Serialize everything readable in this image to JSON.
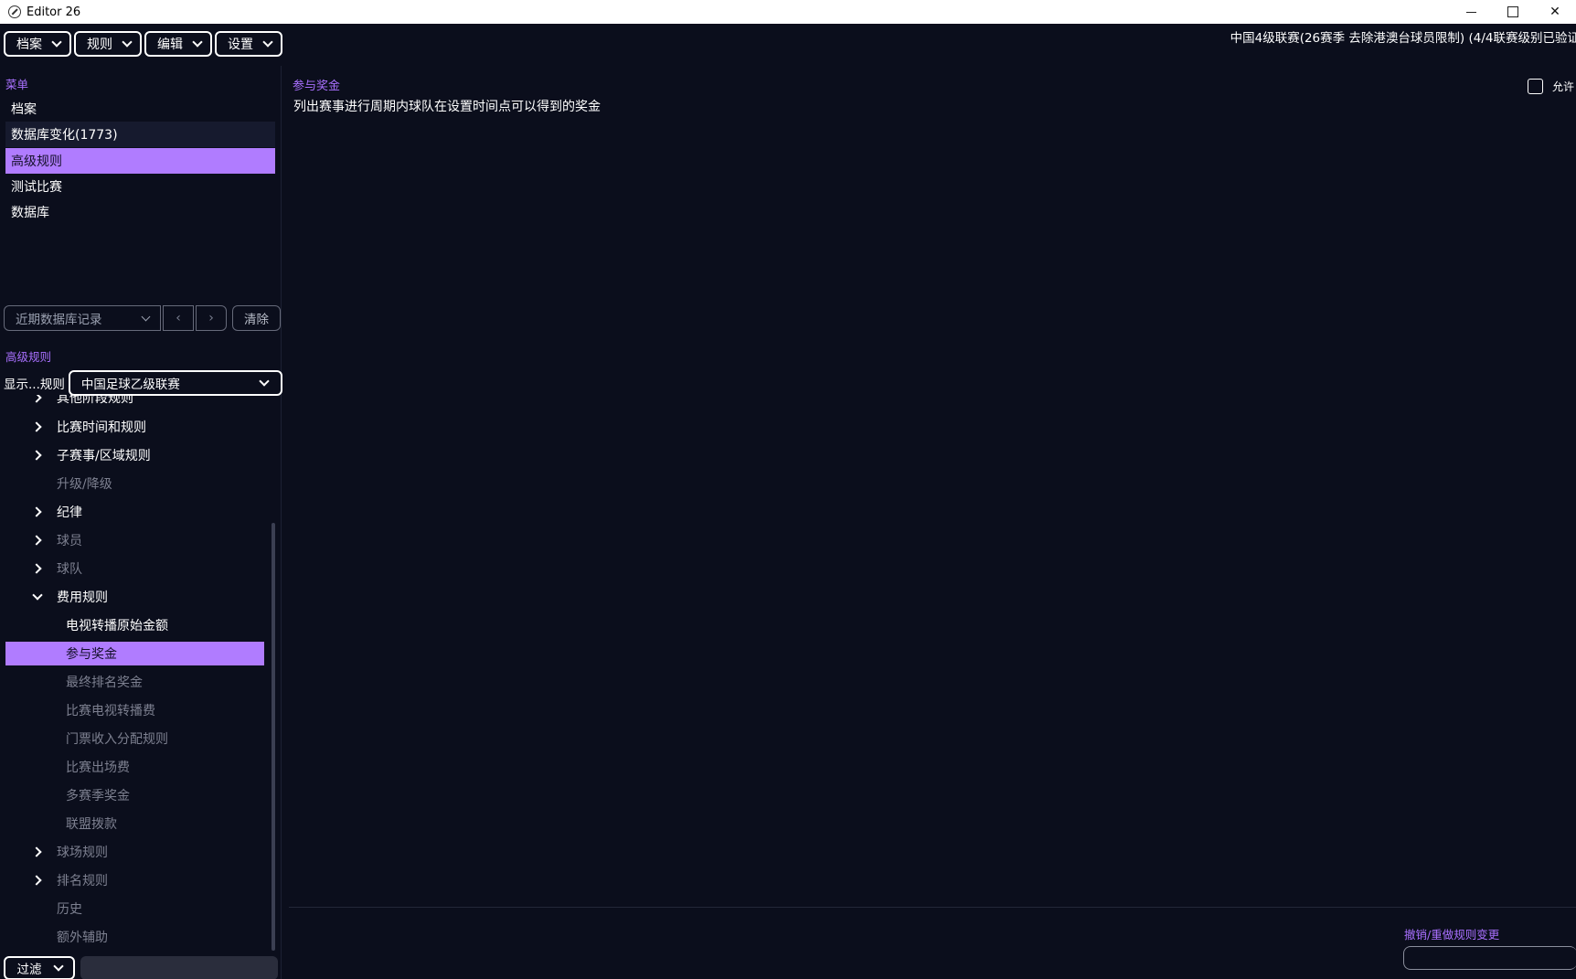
{
  "window": {
    "title": "Editor 26"
  },
  "menubar": {
    "items": [
      {
        "label": "档案"
      },
      {
        "label": "规则"
      },
      {
        "label": "编辑"
      },
      {
        "label": "设置"
      }
    ]
  },
  "header": {
    "league_info": "中国4级联赛(26赛季 去除港澳台球员限制) (4/4联赛级别已验证"
  },
  "sidebar": {
    "menu_label": "菜单",
    "nav": [
      {
        "label": "档案"
      },
      {
        "label": "数据库变化(1773)"
      },
      {
        "label": "高级规则"
      },
      {
        "label": "测试比赛"
      },
      {
        "label": "数据库"
      }
    ],
    "recent": {
      "label": "近期数据库记录",
      "prev": "‹",
      "next": "›",
      "clear": "清除"
    },
    "advanced_label": "高级规则",
    "show_rules_label": "显示...规则",
    "rule_select_value": "中国足球乙级联赛",
    "tree": [
      {
        "label": "其他阶段规则"
      },
      {
        "label": "比赛时间和规则"
      },
      {
        "label": "子赛事/区域规则"
      },
      {
        "label": "升级/降级"
      },
      {
        "label": "纪律"
      },
      {
        "label": "球员"
      },
      {
        "label": "球队"
      },
      {
        "label": "费用规则"
      },
      {
        "label": "电视转播原始金额"
      },
      {
        "label": "参与奖金"
      },
      {
        "label": "最终排名奖金"
      },
      {
        "label": "比赛电视转播费"
      },
      {
        "label": "门票收入分配规则"
      },
      {
        "label": "比赛出场费"
      },
      {
        "label": "多赛季奖金"
      },
      {
        "label": "联盟拨款"
      },
      {
        "label": "球场规则"
      },
      {
        "label": "排名规则"
      },
      {
        "label": "历史"
      },
      {
        "label": "额外辅助"
      }
    ],
    "filter_label": "过滤"
  },
  "main": {
    "title": "参与奖金",
    "description": "列出赛事进行周期内球队在设置时间点可以得到的奖金",
    "allow_label": "允许",
    "undo_label": "撤销/重做规则变更"
  },
  "colors": {
    "background": "#0b0e1c",
    "accent": "#a970ff",
    "selection": "#b07cff",
    "dim_text": "#7d8090"
  }
}
